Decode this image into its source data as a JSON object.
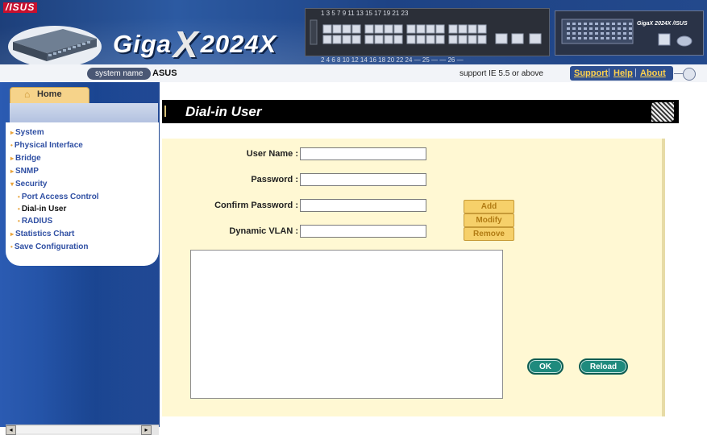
{
  "banner": {
    "brand": "/ISUS",
    "product_name_prefix": "Giga",
    "product_name_x": "X",
    "product_name_suffix": "2024X",
    "port_numbers_top": "1  3  5  7   9  11  13  15   17  19  21  23",
    "port_numbers_bottom": "2  4  6  8   10  12  14  16   18  20  22  24  — 25 —  — 26 —",
    "mini_brand": "GigaX 2024X /ISUS",
    "colors": {
      "banner_blue": "#2c5aa2",
      "brand_red": "#c8102e"
    }
  },
  "status_strip": {
    "system_name_label": "system name",
    "system_name_value": "ASUS",
    "support_note": "support IE 5.5 or above",
    "links": {
      "support": "Support",
      "help": "Help",
      "about": "About"
    },
    "separator": "|"
  },
  "sidebar": {
    "home_icon": "home-icon",
    "home_label": "Home",
    "items": [
      {
        "label": "System",
        "bullet": "▸",
        "sub": false,
        "active": false
      },
      {
        "label": "Physical Interface",
        "bullet": "•",
        "sub": false,
        "active": false
      },
      {
        "label": "Bridge",
        "bullet": "▸",
        "sub": false,
        "active": false
      },
      {
        "label": "SNMP",
        "bullet": "▸",
        "sub": false,
        "active": false
      },
      {
        "label": "Security",
        "bullet": "▾",
        "sub": false,
        "active": false
      },
      {
        "label": "Port Access Control",
        "bullet": "•",
        "sub": true,
        "active": false
      },
      {
        "label": "Dial-in User",
        "bullet": "•",
        "sub": true,
        "active": true
      },
      {
        "label": "RADIUS",
        "bullet": "•",
        "sub": true,
        "active": false
      },
      {
        "label": "Statistics Chart",
        "bullet": "▸",
        "sub": false,
        "active": false
      },
      {
        "label": "Save Configuration",
        "bullet": "•",
        "sub": false,
        "active": false
      }
    ]
  },
  "main": {
    "page_title": "Dial-in User",
    "form": {
      "user_name_label": "User Name :",
      "user_name_value": "",
      "password_label": "Password :",
      "password_value": "",
      "confirm_password_label": "Confirm Password :",
      "confirm_password_value": "",
      "dynamic_vlan_label": "Dynamic VLAN :",
      "dynamic_vlan_value": ""
    },
    "buttons": {
      "add": "Add",
      "modify": "Modify",
      "remove": "Remove",
      "ok": "OK",
      "reload": "Reload"
    },
    "colors": {
      "panel_bg": "#fff8d3",
      "title_bar": "#000000",
      "action_button": "#1f8a7d",
      "side_button": "#f6d06a"
    }
  },
  "scrollbar": {
    "left_arrow": "◂",
    "right_arrow": "▸"
  }
}
